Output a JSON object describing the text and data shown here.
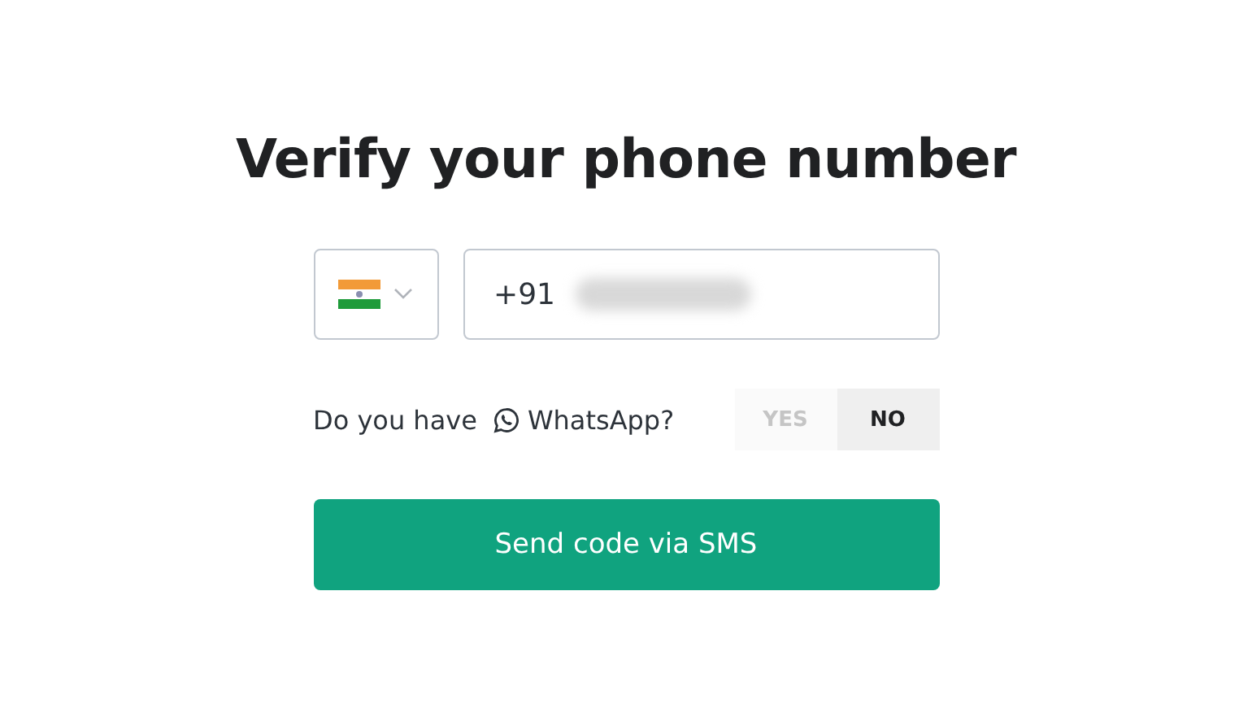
{
  "title": "Verify your phone number",
  "phone": {
    "dial_code": "+91",
    "country_expanded": false
  },
  "whatsapp": {
    "prefix": "Do you have",
    "name": "WhatsApp?",
    "options": [
      {
        "label": "YES",
        "selected": false
      },
      {
        "label": "NO",
        "selected": true
      }
    ]
  },
  "submit": "Send code via SMS"
}
